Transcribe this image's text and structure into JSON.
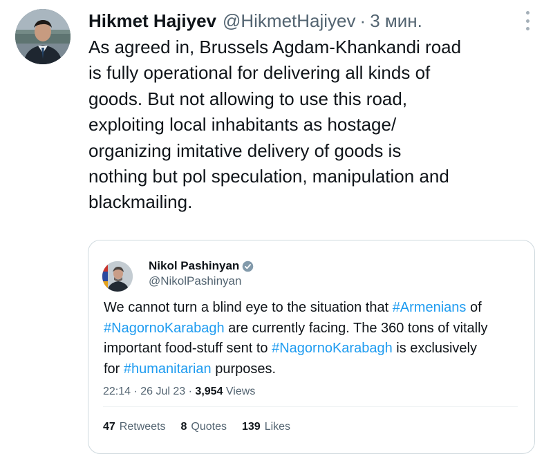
{
  "tweet": {
    "author_name": "Hikmet Hajiyev",
    "author_handle": "@HikmetHajiyev",
    "separator": "·",
    "time": "3 мин.",
    "text_lines": [
      "As agreed in, Brussels Agdam-Khankandi road",
      "is fully operational for delivering all kinds of",
      "goods. But not allowing to use this road,",
      "exploiting local inhabitants as hostage/",
      "organizing imitative delivery of goods is",
      "nothing but pol speculation, manipulation and",
      "blackmailing."
    ]
  },
  "quote": {
    "author_name": "Nikol Pashinyan",
    "author_handle": "@NikolPashinyan",
    "text": {
      "p1": "We cannot turn a blind eye to the situation that ",
      "tag1": "#Armenians",
      "p2": " of",
      "tag2": "#NagornoKarabagh",
      "p3": " are currently facing. The 360 tons of vitally",
      "p4": "important food-stuff sent to ",
      "tag3": "#NagornoKarabagh",
      "p5": " is exclusively",
      "p6": "for ",
      "tag4": "#humanitarian",
      "p7": " purposes."
    },
    "timestamp": "22:14 · 26 Jul 23 · ",
    "views_count": "3,954",
    "views_label": "Views",
    "retweets_count": "47",
    "retweets_label": "Retweets",
    "quotes_count": "8",
    "quotes_label": "Quotes",
    "likes_count": "139",
    "likes_label": "Likes"
  },
  "icons": {
    "verified": "verified-badge-icon",
    "more": "more-options-icon"
  },
  "colors": {
    "link": "#1d9bf0",
    "secondary_text": "#536471",
    "primary_text": "#0f1419",
    "border": "#cfd9de"
  }
}
